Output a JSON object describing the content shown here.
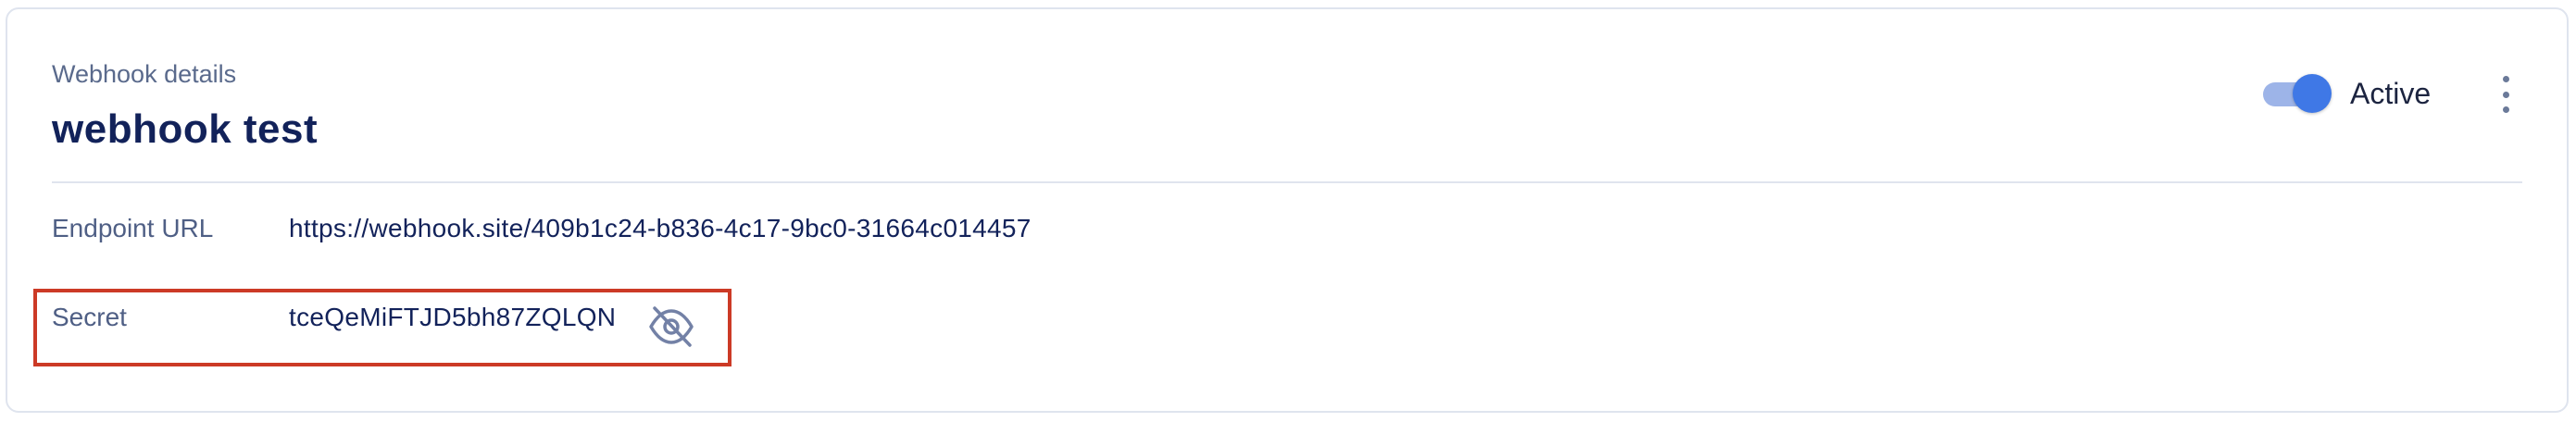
{
  "card": {
    "eyebrow": "Webhook details",
    "title": "webhook test"
  },
  "status": {
    "label": "Active",
    "active": true,
    "accent_color": "#3f78e6"
  },
  "more_menu": {
    "icon": "more-vertical-icon"
  },
  "details": {
    "endpoint_label": "Endpoint URL",
    "endpoint_value": "https://webhook.site/409b1c24-b836-4c17-9bc0-31664c014457",
    "secret_label": "Secret",
    "secret_value": "tceQeMiFTJD5bh87ZQLQN",
    "secret_toggle_icon": "eye-off-icon"
  },
  "highlight_color": "#cc3a26"
}
